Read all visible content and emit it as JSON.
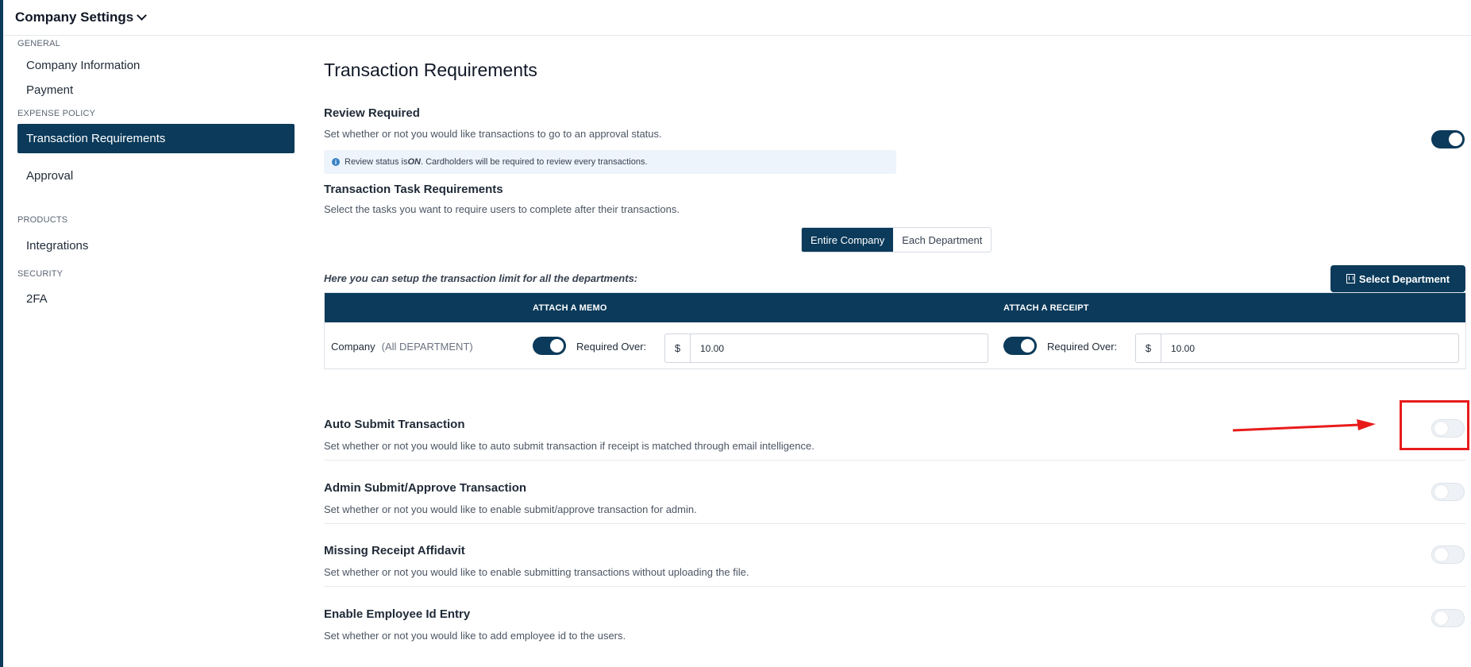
{
  "header": {
    "title": "Company Settings"
  },
  "sidebar": {
    "sections": [
      {
        "heading": "GENERAL",
        "items": [
          {
            "label": "Company Information"
          },
          {
            "label": "Payment"
          }
        ]
      },
      {
        "heading": "EXPENSE POLICY",
        "items": [
          {
            "label": "Transaction Requirements",
            "active": true
          },
          {
            "label": "Approval"
          }
        ]
      },
      {
        "heading": "PRODUCTS",
        "items": [
          {
            "label": "Integrations"
          }
        ]
      },
      {
        "heading": "SECURITY",
        "items": [
          {
            "label": "2FA"
          }
        ]
      }
    ]
  },
  "main": {
    "title": "Transaction Requirements",
    "review": {
      "title": "Review Required",
      "description": "Set whether or not you would like transactions to go to an approval status.",
      "enabled": true,
      "info_prefix": "Review status is ",
      "info_state": "ON",
      "info_suffix": ". Cardholders will be required to review every transactions."
    },
    "task": {
      "title": "Transaction Task Requirements",
      "description": "Select the tasks you want to require users to complete after their transactions.",
      "scope_tabs": [
        {
          "label": "Entire Company",
          "selected": true
        },
        {
          "label": "Each Department",
          "selected": false
        }
      ],
      "limit_note": "Here you can setup the transaction limit for all the departments:",
      "select_department_label": "Select Department",
      "table": {
        "columns": {
          "memo": "ATTACH A MEMO",
          "receipt": "ATTACH A RECEIPT"
        },
        "row": {
          "name": "Company",
          "scope": "(All DEPARTMENT)",
          "memo_enabled": true,
          "memo_required_label": "Required Over:",
          "memo_currency": "$",
          "memo_amount": "10.00",
          "receipt_enabled": true,
          "receipt_required_label": "Required Over:",
          "receipt_currency": "$",
          "receipt_amount": "10.00"
        }
      }
    },
    "settings": [
      {
        "title": "Auto Submit Transaction",
        "description": "Set whether or not you would like to auto submit transaction if receipt is matched through email intelligence.",
        "enabled": false
      },
      {
        "title": "Admin Submit/Approve Transaction",
        "description": "Set whether or not you would like to enable submit/approve transaction for admin.",
        "enabled": false
      },
      {
        "title": "Missing Receipt Affidavit",
        "description": "Set whether or not you would like to enable submitting transactions without uploading the file.",
        "enabled": false
      },
      {
        "title": "Enable Employee Id Entry",
        "description": "Set whether or not you would like to add employee id to the users.",
        "enabled": false
      }
    ]
  },
  "colors": {
    "brand": "#0b3a5a",
    "annotation": "#e81b1b",
    "info_bg": "#eef4fb"
  }
}
